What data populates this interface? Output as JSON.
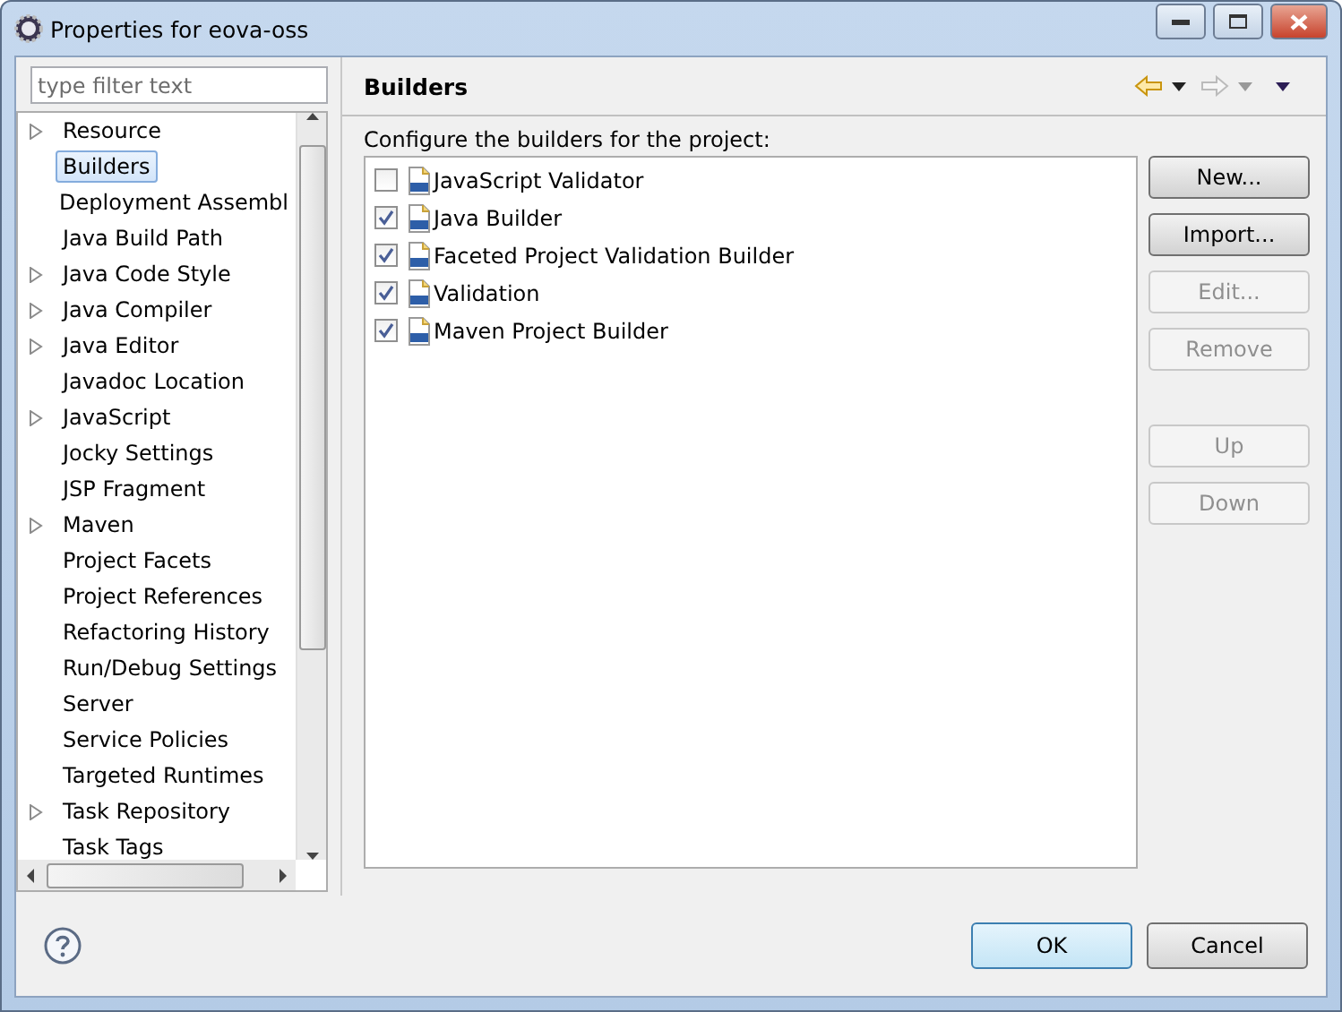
{
  "window": {
    "title": "Properties for eova-oss"
  },
  "filter": {
    "placeholder": "type filter text"
  },
  "tree": [
    {
      "label": "Resource",
      "has_children": true,
      "selected": false
    },
    {
      "label": "Builders",
      "has_children": false,
      "selected": true
    },
    {
      "label": "Deployment Assembl",
      "has_children": false,
      "selected": false
    },
    {
      "label": "Java Build Path",
      "has_children": false,
      "selected": false
    },
    {
      "label": "Java Code Style",
      "has_children": true,
      "selected": false
    },
    {
      "label": "Java Compiler",
      "has_children": true,
      "selected": false
    },
    {
      "label": "Java Editor",
      "has_children": true,
      "selected": false
    },
    {
      "label": "Javadoc Location",
      "has_children": false,
      "selected": false
    },
    {
      "label": "JavaScript",
      "has_children": true,
      "selected": false
    },
    {
      "label": "Jocky Settings",
      "has_children": false,
      "selected": false
    },
    {
      "label": "JSP Fragment",
      "has_children": false,
      "selected": false
    },
    {
      "label": "Maven",
      "has_children": true,
      "selected": false
    },
    {
      "label": "Project Facets",
      "has_children": false,
      "selected": false
    },
    {
      "label": "Project References",
      "has_children": false,
      "selected": false
    },
    {
      "label": "Refactoring History",
      "has_children": false,
      "selected": false
    },
    {
      "label": "Run/Debug Settings",
      "has_children": false,
      "selected": false
    },
    {
      "label": "Server",
      "has_children": false,
      "selected": false
    },
    {
      "label": "Service Policies",
      "has_children": false,
      "selected": false
    },
    {
      "label": "Targeted Runtimes",
      "has_children": false,
      "selected": false
    },
    {
      "label": "Task Repository",
      "has_children": true,
      "selected": false
    },
    {
      "label": "Task Tags",
      "has_children": false,
      "selected": false
    }
  ],
  "page": {
    "title": "Builders",
    "description": "Configure the builders for the project:"
  },
  "builders": [
    {
      "label": "JavaScript Validator",
      "checked": false
    },
    {
      "label": "Java Builder",
      "checked": true
    },
    {
      "label": "Faceted Project Validation Builder",
      "checked": true
    },
    {
      "label": "Validation",
      "checked": true
    },
    {
      "label": "Maven Project Builder",
      "checked": true
    }
  ],
  "side_buttons": [
    {
      "label": "New...",
      "disabled": false
    },
    {
      "label": "Import...",
      "disabled": false
    },
    {
      "label": "Edit...",
      "disabled": true
    },
    {
      "label": "Remove",
      "disabled": true
    },
    {
      "label": "Up",
      "disabled": true
    },
    {
      "label": "Down",
      "disabled": true
    }
  ],
  "footer_buttons": [
    {
      "label": "OK",
      "kind": "default"
    },
    {
      "label": "Cancel",
      "kind": "normal"
    }
  ]
}
